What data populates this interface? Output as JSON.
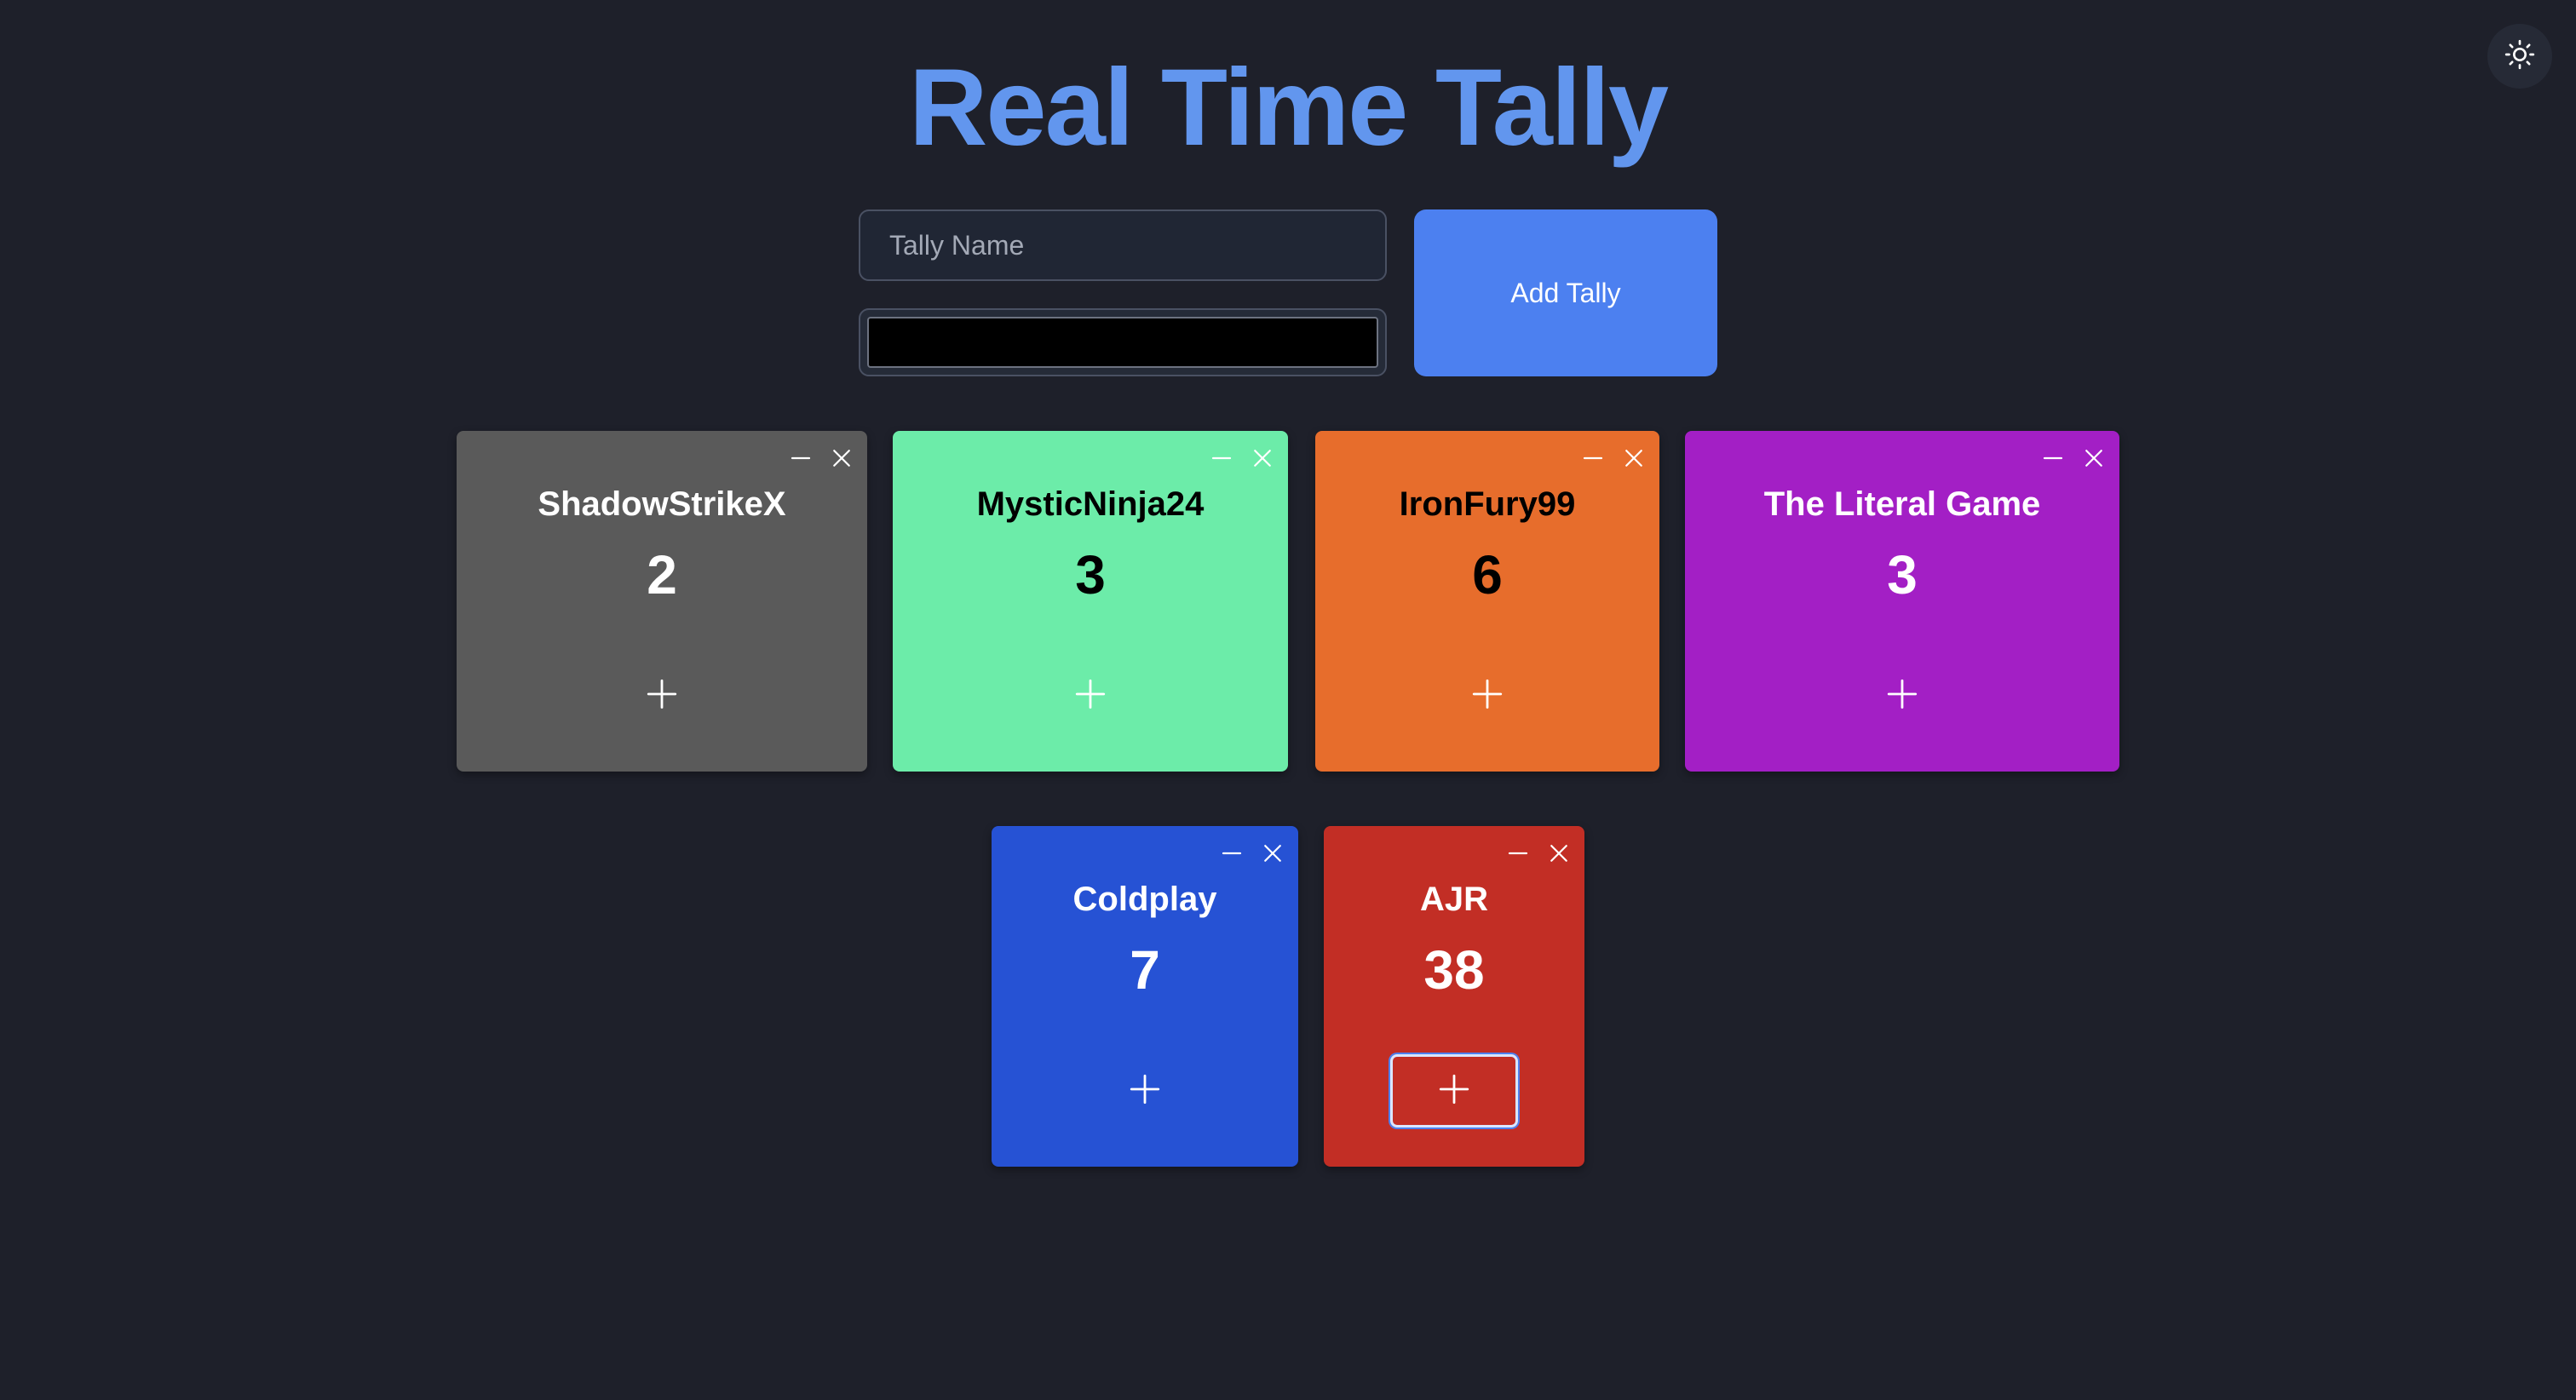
{
  "app": {
    "title": "Real Time Tally"
  },
  "header": {
    "theme_toggle_icon": "sun-icon"
  },
  "form": {
    "name_placeholder": "Tally Name",
    "name_value": "",
    "color_value": "#000000",
    "add_label": "Add Tally"
  },
  "tallies": [
    {
      "name": "ShadowStrikeX",
      "count": "2",
      "color": "#5a5a5a",
      "text_color": "#ffffff"
    },
    {
      "name": "MysticNinja24",
      "count": "3",
      "color": "#6ceca9",
      "text_color": "#000000"
    },
    {
      "name": "IronFury99",
      "count": "6",
      "color": "#e76d2c",
      "text_color": "#000000"
    },
    {
      "name": "The Literal Game",
      "count": "3",
      "color": "#a31fc5",
      "text_color": "#ffffff"
    },
    {
      "name": "Coldplay",
      "count": "7",
      "color": "#2652d4",
      "text_color": "#ffffff"
    },
    {
      "name": "AJR",
      "count": "38",
      "color": "#c22e25",
      "text_color": "#ffffff"
    }
  ],
  "card_controls": {
    "decrement_icon": "minus-icon",
    "remove_icon": "close-icon",
    "increment_icon": "plus-icon"
  }
}
